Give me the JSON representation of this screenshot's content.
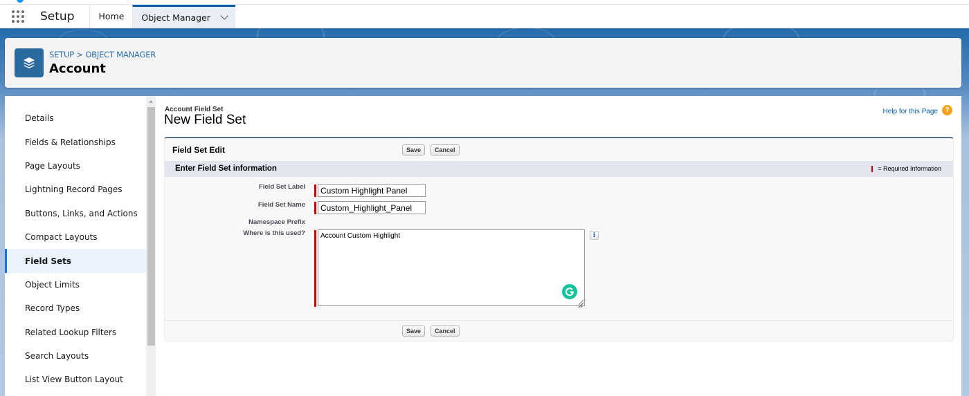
{
  "nav": {
    "app_name": "Setup",
    "tabs": [
      {
        "label": "Home",
        "active": false
      },
      {
        "label": "Object Manager",
        "active": true
      }
    ]
  },
  "header": {
    "breadcrumb": [
      "SETUP",
      "OBJECT MANAGER"
    ],
    "breadcrumb_separator": ">",
    "object_title": "Account",
    "icon": "stacked-layers-icon"
  },
  "sidebar": {
    "items": [
      {
        "label": "Details",
        "active": false
      },
      {
        "label": "Fields & Relationships",
        "active": false
      },
      {
        "label": "Page Layouts",
        "active": false
      },
      {
        "label": "Lightning Record Pages",
        "active": false
      },
      {
        "label": "Buttons, Links, and Actions",
        "active": false
      },
      {
        "label": "Compact Layouts",
        "active": false
      },
      {
        "label": "Field Sets",
        "active": true
      },
      {
        "label": "Object Limits",
        "active": false
      },
      {
        "label": "Record Types",
        "active": false
      },
      {
        "label": "Related Lookup Filters",
        "active": false
      },
      {
        "label": "Search Layouts",
        "active": false
      },
      {
        "label": "List View Button Layout",
        "active": false
      }
    ]
  },
  "page": {
    "type_label": "Account Field Set",
    "title": "New Field Set",
    "help_link": "Help for this Page",
    "help_icon": "?"
  },
  "form": {
    "block_title": "Field Set Edit",
    "save_label": "Save",
    "cancel_label": "Cancel",
    "section_title": "Enter Field Set information",
    "required_legend": "= Required Information",
    "fields": {
      "label": {
        "label": "Field Set Label",
        "value": "Custom Highlight Panel",
        "required": true
      },
      "name": {
        "label": "Field Set Name",
        "value": "Custom_Highlight_Panel",
        "required": true
      },
      "namespace": {
        "label": "Namespace Prefix",
        "value": ""
      },
      "where_used": {
        "label": "Where is this used?",
        "value": "Account Custom Highlight",
        "required": true
      }
    },
    "info_icon": "i"
  },
  "colors": {
    "brand_blue": "#0b5cab",
    "object_icon_bg": "#2a6a9e",
    "required_red": "#cc0000",
    "help_orange": "#f3a21b",
    "grammarly_green": "#15c39a",
    "active_sidebar_bar": "#1b6ee0"
  }
}
